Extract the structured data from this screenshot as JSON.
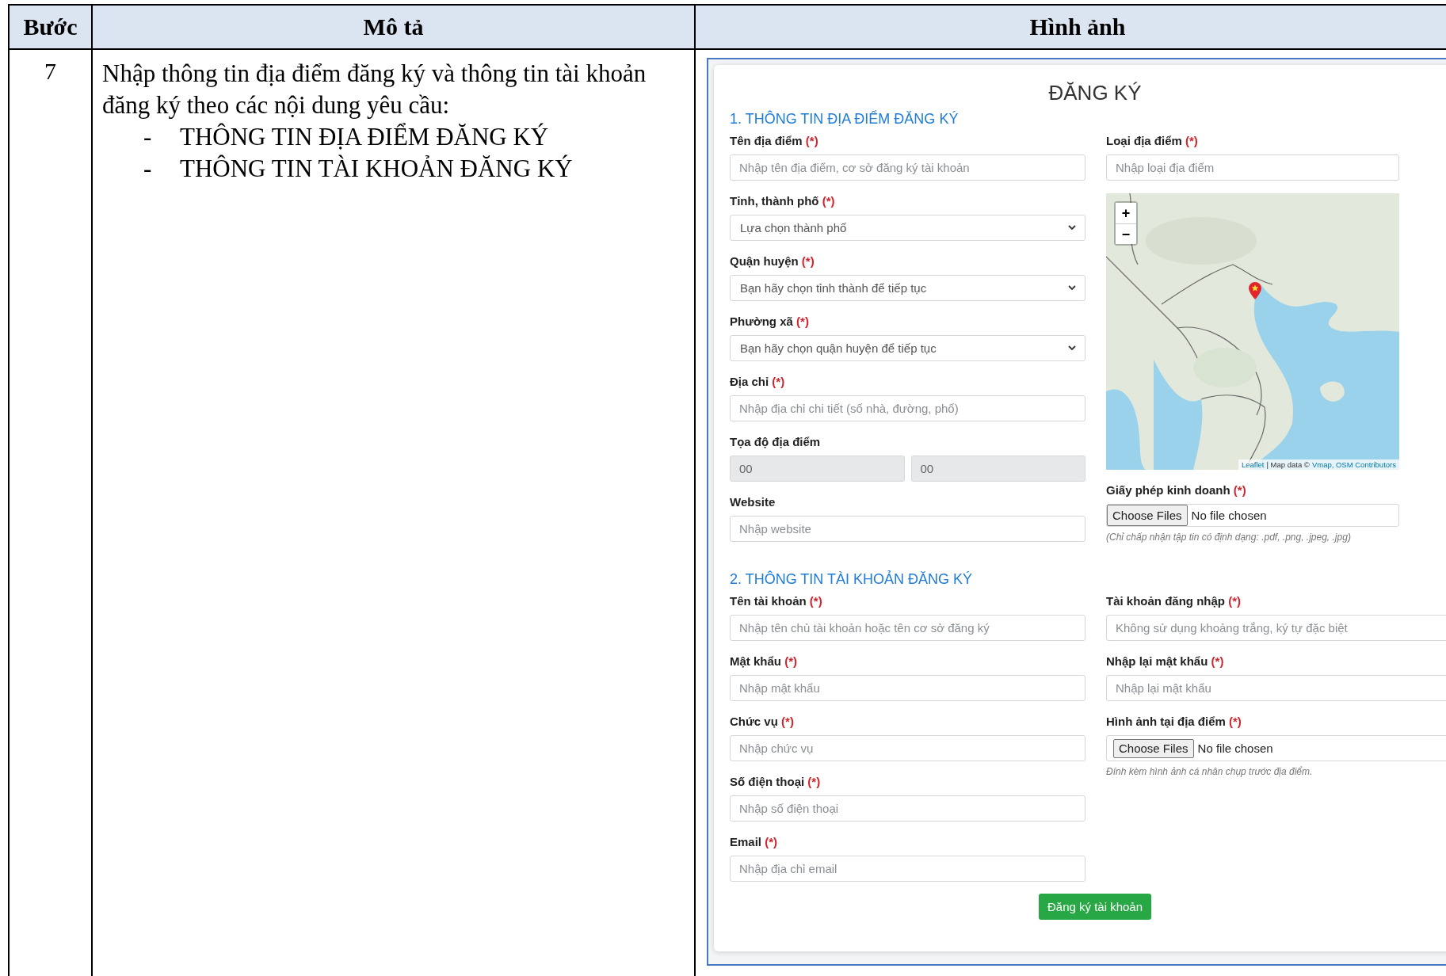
{
  "table": {
    "columns": [
      {
        "label": "Bước"
      },
      {
        "label": "Mô tả"
      },
      {
        "label": "Hình ảnh"
      }
    ],
    "rows": [
      {
        "step": "7",
        "description": "Nhập thông tin địa điểm đăng ký và thông tin tài khoản đăng ký theo các nội dung yêu cầu:",
        "bullets": [
          {
            "marker": "-",
            "text": "THÔNG TIN ĐỊA ĐIỂM ĐĂNG KÝ"
          },
          {
            "marker": "-",
            "text": "THÔNG TIN TÀI KHOẢN ĐĂNG KÝ"
          }
        ],
        "screenshot": {
          "title": "ĐĂNG KÝ",
          "sections": [
            {
              "heading": "1. THÔNG TIN ĐỊA ĐIỂM ĐĂNG KÝ",
              "left": [
                {
                  "kind": "text",
                  "label": "Tên địa điểm",
                  "required_mark": "(*)",
                  "placeholder": "Nhập tên địa điểm, cơ sở đăng ký tài khoản"
                },
                {
                  "kind": "select",
                  "label": "Tỉnh, thành phố",
                  "required_mark": "(*)",
                  "value": "Lựa chọn thành phố"
                },
                {
                  "kind": "select",
                  "label": "Quận huyện",
                  "required_mark": "(*)",
                  "value": "Bạn hãy chọn tỉnh thành để tiếp tục"
                },
                {
                  "kind": "select",
                  "label": "Phường xã",
                  "required_mark": "(*)",
                  "value": "Bạn hãy chọn quận huyện để tiếp tục"
                },
                {
                  "kind": "text",
                  "label": "Địa chỉ",
                  "required_mark": "(*)",
                  "placeholder": "Nhập địa chỉ chi tiết (số nhà, đường, phố)"
                },
                {
                  "kind": "pair",
                  "label": "Tọa độ địa điểm",
                  "values": [
                    "00",
                    "00"
                  ],
                  "disabled": true
                },
                {
                  "kind": "text",
                  "label": "Website",
                  "placeholder": "Nhập website"
                }
              ],
              "right": [
                {
                  "kind": "text",
                  "label": "Loại địa điểm",
                  "required_mark": "(*)",
                  "placeholder": "Nhập loại địa điểm"
                },
                {
                  "kind": "map",
                  "zoom_in": "+",
                  "zoom_out": "−",
                  "attribution": [
                    {
                      "text": "Leaflet",
                      "link": true
                    },
                    {
                      "text": "| Map data ©",
                      "link": false
                    },
                    {
                      "text": "Vmap, OSM Contributors",
                      "link": true
                    }
                  ]
                },
                {
                  "kind": "file",
                  "label": "Giấy phép kinh doanh",
                  "required_mark": "(*)",
                  "button": "Choose Files",
                  "status": "No file chosen",
                  "hint": "(Chỉ chấp nhận tập tin có định dạng: .pdf, .png, .jpeg, .jpg)"
                }
              ]
            },
            {
              "heading": "2. THÔNG TIN TÀI KHOẢN ĐĂNG KÝ",
              "left": [
                {
                  "kind": "text",
                  "label": "Tên tài khoản",
                  "required_mark": "(*)",
                  "placeholder": "Nhập tên chủ tài khoản hoặc tên cơ sở đăng ký"
                },
                {
                  "kind": "text",
                  "label": "Mật khẩu",
                  "required_mark": "(*)",
                  "placeholder": "Nhập mật khẩu"
                },
                {
                  "kind": "text",
                  "label": "Chức vụ",
                  "required_mark": "(*)",
                  "placeholder": "Nhập chức vụ"
                },
                {
                  "kind": "text",
                  "label": "Số điện thoại",
                  "required_mark": "(*)",
                  "placeholder": "Nhập số điện thoại"
                },
                {
                  "kind": "text",
                  "label": "Email",
                  "required_mark": "(*)",
                  "placeholder": "Nhập địa chỉ email"
                }
              ],
              "right": [
                {
                  "kind": "text",
                  "label": "Tài khoản đăng nhập",
                  "required_mark": "(*)",
                  "placeholder": "Không sử dụng khoảng trắng, ký tự đặc biệt"
                },
                {
                  "kind": "text",
                  "label": "Nhập lại mật khẩu",
                  "required_mark": "(*)",
                  "placeholder": "Nhập lại mật khẩu"
                },
                {
                  "kind": "file",
                  "label": "Hình ảnh tại địa điểm",
                  "required_mark": "(*)",
                  "button": "Choose Files",
                  "status": "No file chosen",
                  "hint": "Đính kèm hình ảnh cá nhân chụp trước địa điểm."
                }
              ]
            }
          ],
          "submit": "Đăng ký tài khoản"
        }
      }
    ]
  }
}
